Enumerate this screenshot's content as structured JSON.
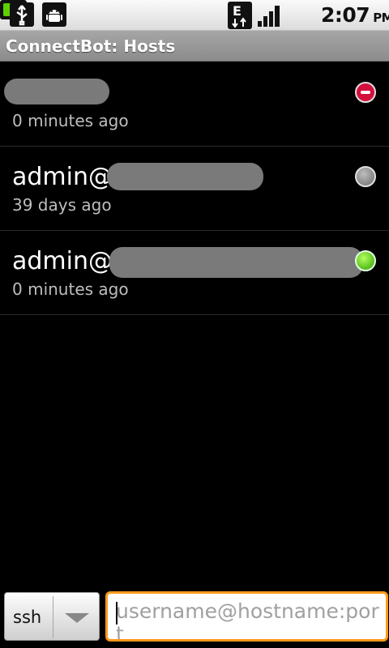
{
  "status_bar": {
    "time": "2:07",
    "ampm": "PM",
    "icons": [
      "usb-icon",
      "android-debug-icon",
      "edge-network-icon",
      "signal-icon",
      "battery-icon"
    ]
  },
  "app": {
    "title": "ConnectBot: Hosts"
  },
  "hosts": [
    {
      "name": "",
      "last_connected": "0 minutes ago",
      "status": "error",
      "redacted": true
    },
    {
      "name": "admin@",
      "last_connected": "39 days ago",
      "status": "offline",
      "redacted": true
    },
    {
      "name": "admin@",
      "last_connected": "0 minutes ago",
      "status": "online",
      "redacted": true
    }
  ],
  "bottom_bar": {
    "protocol": "ssh",
    "host_input": {
      "value": "",
      "placeholder": "username@hostname:port"
    }
  },
  "colors": {
    "status_error": "#d3103c",
    "status_offline": "#8c8c8c",
    "status_online": "#5fd000",
    "input_focus": "#ff9a1a"
  }
}
